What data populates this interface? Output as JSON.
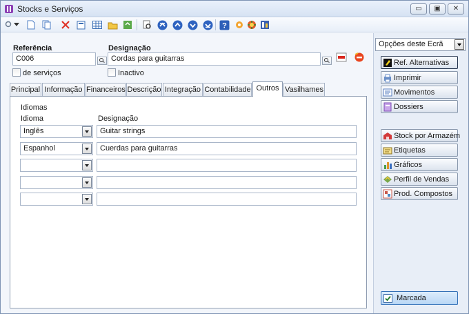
{
  "window": {
    "title": "Stocks e Serviços"
  },
  "titlebar_buttons": {
    "minimize": "▭",
    "maximize": "▣",
    "close": "✕"
  },
  "toolbar": {
    "icons": [
      "search-icon",
      "dropdown-icon",
      "new-icon",
      "copy-icon",
      "delete-icon",
      "edit-icon",
      "grid-icon",
      "folder-icon",
      "refresh-icon",
      "preview-icon",
      "first-icon",
      "previous-icon",
      "next-icon",
      "last-icon",
      "help-icon",
      "settings-icon",
      "plugin-icon",
      "export-icon"
    ]
  },
  "form": {
    "referencia": {
      "label": "Referência",
      "value": "C006"
    },
    "designacao": {
      "label": "Designação",
      "value": "Cordas para guitarras"
    },
    "de_servicos": {
      "label": "de serviços",
      "checked": false
    },
    "inactivo": {
      "label": "Inactivo",
      "checked": false
    }
  },
  "tabs": [
    {
      "label": "Principal",
      "active": false
    },
    {
      "label": "Informação",
      "active": false
    },
    {
      "label": "Financeiros",
      "active": false
    },
    {
      "label": "Descrição",
      "active": false
    },
    {
      "label": "Integração",
      "active": false
    },
    {
      "label": "Contabilidade",
      "active": false
    },
    {
      "label": "Outros",
      "active": true
    },
    {
      "label": "Vasilhames",
      "active": false
    }
  ],
  "outros": {
    "section_title": "Idiomas",
    "col_idioma": "Idioma",
    "col_designacao": "Designação",
    "rows": [
      {
        "idioma": "Inglês",
        "designacao": "Guitar strings"
      },
      {
        "idioma": "Espanhol",
        "designacao": "Cuerdas para guitarras"
      },
      {
        "idioma": "",
        "designacao": ""
      },
      {
        "idioma": "",
        "designacao": ""
      },
      {
        "idioma": "",
        "designacao": ""
      }
    ]
  },
  "right_pane": {
    "options_label": "Opções deste Ecrã",
    "buttons_top": [
      {
        "label": "Ref. Alternativas",
        "icon": "alternate-ref-icon",
        "color": "#1b1b1b"
      },
      {
        "label": "Imprimir",
        "icon": "print-icon",
        "color": "#6a8fc8"
      },
      {
        "label": "Movimentos",
        "icon": "movements-icon",
        "color": "#5a7fc0"
      },
      {
        "label": "Dossiers",
        "icon": "dossiers-icon",
        "color": "#9b6cc9"
      }
    ],
    "buttons_bottom": [
      {
        "label": "Stock por Armazém",
        "icon": "warehouse-stock-icon",
        "color": "#d23a3a"
      },
      {
        "label": "Etiquetas",
        "icon": "labels-icon",
        "color": "#d8b64a"
      },
      {
        "label": "Gráficos",
        "icon": "charts-icon",
        "color": "#4a9e4a"
      },
      {
        "label": "Perfil de Vendas",
        "icon": "sales-profile-icon",
        "color": "#7aa84a"
      },
      {
        "label": "Prod. Compostos",
        "icon": "composite-products-icon",
        "color": "#c8584a"
      }
    ],
    "marca": {
      "label": "Marcada",
      "checked": true
    }
  }
}
